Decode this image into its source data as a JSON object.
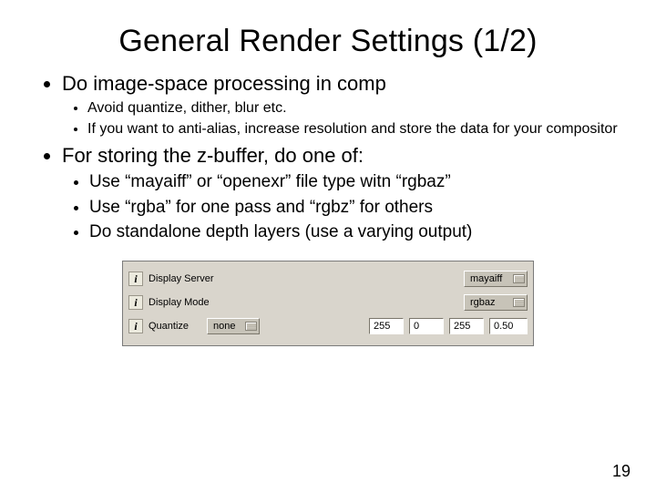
{
  "title": "General Render Settings (1/2)",
  "bullets": {
    "b1": "Do image-space processing in comp",
    "b1a": "Avoid quantize, dither, blur etc.",
    "b1b": "If you want to anti-alias, increase resolution and store the data for your compositor",
    "b2": "For storing the z-buffer, do one of:",
    "b2a": "Use “mayaiff” or “openexr” file type witn “rgbaz”",
    "b2b": "Use “rgba” for one pass and “rgbz” for others",
    "b2c": "Do standalone depth layers (use a varying output)"
  },
  "panel": {
    "icon_glyph": "i",
    "rows": {
      "display_server": {
        "label": "Display Server",
        "value": "mayaiff"
      },
      "display_mode": {
        "label": "Display Mode",
        "value": "rgbaz"
      },
      "quantize": {
        "label": "Quantize",
        "dropdown": "none",
        "v1": "255",
        "v2": "0",
        "v3": "255",
        "v4": "0.50"
      }
    }
  },
  "page_number": "19"
}
